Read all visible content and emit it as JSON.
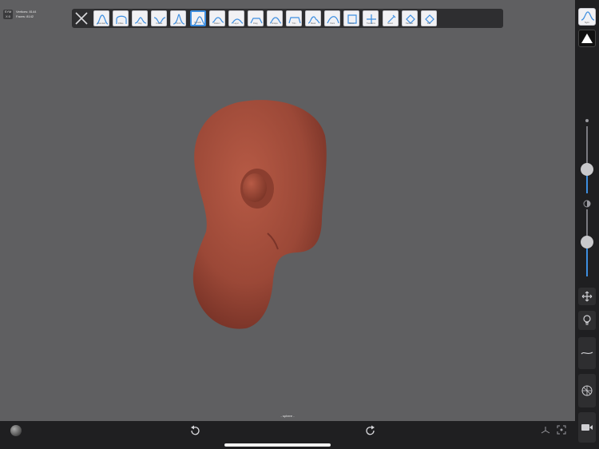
{
  "stats": {
    "badge_lines": [
      "SYM",
      "X:0"
    ],
    "vertices": "Vertices: 8144",
    "faces": "Faces:   8142"
  },
  "tools": [
    {
      "name": "tool-x"
    },
    {
      "name": "tool-standard",
      "label": "Standard"
    },
    {
      "name": "tool-inflate",
      "label": "Inflate"
    },
    {
      "name": "tool-clay",
      "label": "Clay"
    },
    {
      "name": "tool-crease",
      "label": "Crease"
    },
    {
      "name": "tool-pinch",
      "label": "Pinch"
    },
    {
      "name": "tool-smooth-selected",
      "label": "Smooth",
      "active": true
    },
    {
      "name": "tool-flatten",
      "label": "Flatten"
    },
    {
      "name": "tool-layer",
      "label": "Layer"
    },
    {
      "name": "tool-drag",
      "label": "Drag"
    },
    {
      "name": "tool-scrape",
      "label": "Scrape"
    },
    {
      "name": "tool-trim",
      "label": "Trim"
    },
    {
      "name": "tool-mask",
      "label": "Mask"
    },
    {
      "name": "tool-paint",
      "label": "Paint"
    },
    {
      "name": "tool-move",
      "label": "Move"
    },
    {
      "name": "tool-transform",
      "label": "Transform"
    },
    {
      "name": "tool-select",
      "label": "Select"
    },
    {
      "name": "tool-hammer",
      "label": "Hammer"
    },
    {
      "name": "tool-extra",
      "label": "Tool"
    }
  ],
  "scene": {
    "label": "- sphere -"
  },
  "right_rail": {
    "symmetry_label": "Sym",
    "slider1": {
      "value": 0.47
    },
    "slider2": {
      "value": 0.42
    }
  },
  "colors": {
    "viewport_bg": "#5f5f61",
    "panel_bg": "#1f1f21",
    "accent": "#3d8ee0",
    "mesh": "#9b4837"
  }
}
